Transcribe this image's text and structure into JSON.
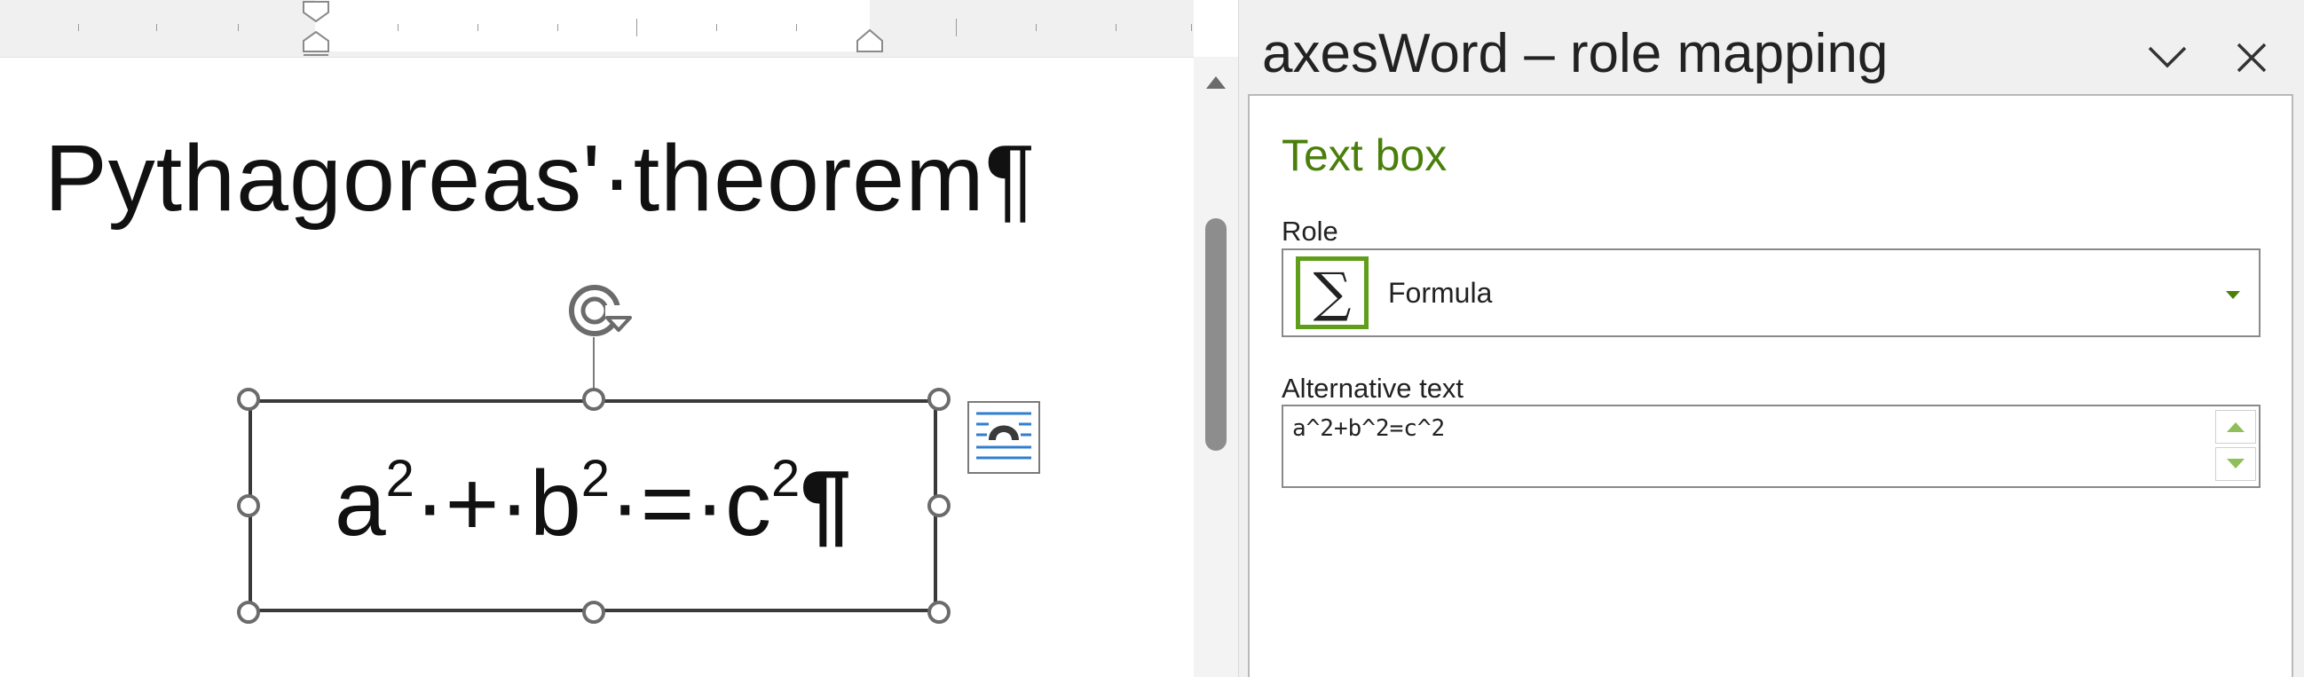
{
  "document": {
    "title": "Pythagoreas'·theorem¶",
    "formula_base_a": "a",
    "formula_exp_a": "2",
    "formula_plus": "·+·",
    "formula_base_b": "b",
    "formula_exp_b": "2",
    "formula_eq": "·=·",
    "formula_base_c": "c",
    "formula_exp_c": "2",
    "formula_pilcrow": "¶"
  },
  "pane": {
    "title": "axesWord – role mapping",
    "section_title": "Text box",
    "role_label": "Role",
    "role_value": "Formula",
    "role_icon_glyph": "∑",
    "alt_label": "Alternative text",
    "alt_value": "a^2+b^2=c^2"
  },
  "icons": {
    "role_icon": "sigma-icon",
    "pane_menu": "chevron-down-icon",
    "pane_close": "close-icon",
    "rotate": "rotate-icon",
    "layout_options": "layout-options-icon"
  },
  "colors": {
    "accent_green": "#4a7f0a",
    "icon_border_green": "#5f9e1a",
    "spinner_green": "#8fbf5a"
  }
}
